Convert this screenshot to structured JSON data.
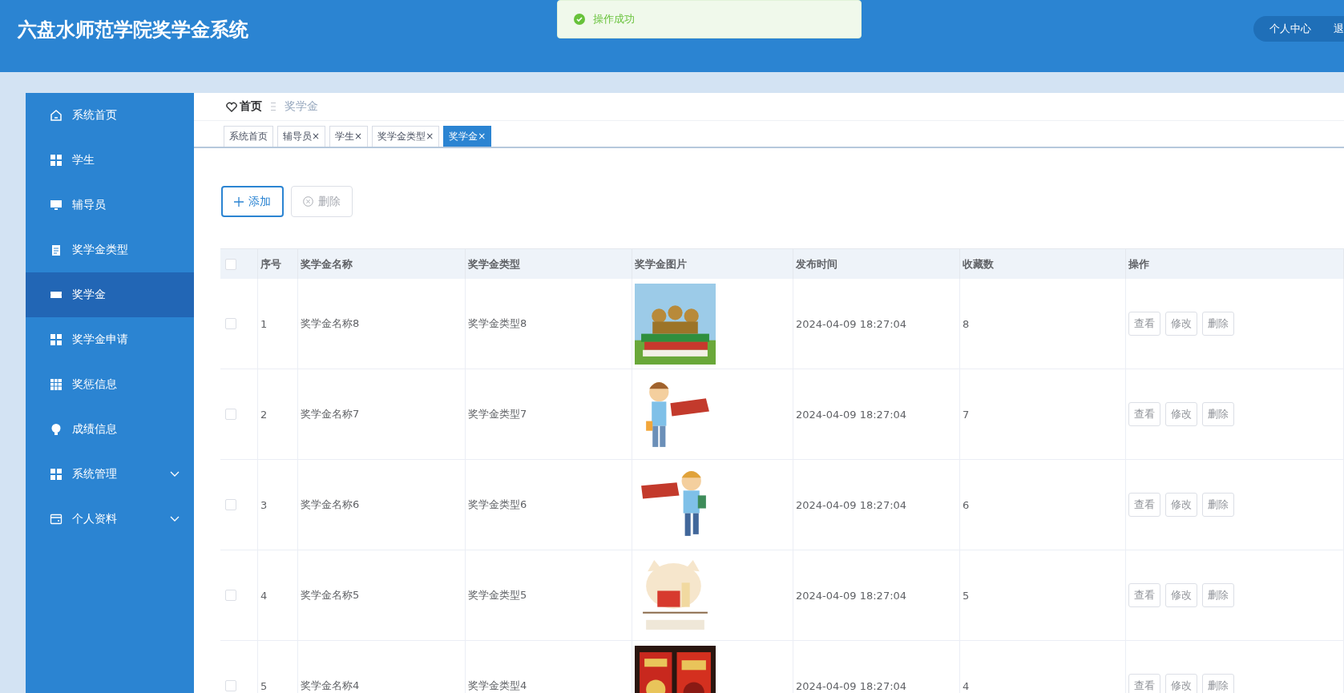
{
  "header": {
    "title": "六盘水师范学院奖学金系统",
    "links": [
      "个人中心",
      "退"
    ]
  },
  "toast": {
    "message": "操作成功"
  },
  "sidebar": {
    "items": [
      {
        "label": "系统首页",
        "kind": "home",
        "selected": false,
        "expandable": false
      },
      {
        "label": "学生",
        "kind": "grid",
        "selected": false,
        "expandable": false
      },
      {
        "label": "辅导员",
        "kind": "monitor",
        "selected": false,
        "expandable": false
      },
      {
        "label": "奖学金类型",
        "kind": "clipboard",
        "selected": false,
        "expandable": false
      },
      {
        "label": "奖学金",
        "kind": "ticket",
        "selected": true,
        "expandable": false
      },
      {
        "label": "奖学金申请",
        "kind": "grid",
        "selected": false,
        "expandable": false
      },
      {
        "label": "奖惩信息",
        "kind": "table",
        "selected": false,
        "expandable": false
      },
      {
        "label": "成绩信息",
        "kind": "bulb",
        "selected": false,
        "expandable": false
      },
      {
        "label": "系统管理",
        "kind": "grid",
        "selected": false,
        "expandable": true
      },
      {
        "label": "个人资料",
        "kind": "wallet",
        "selected": false,
        "expandable": true
      }
    ]
  },
  "breadcrumb": {
    "home": "首页",
    "current": "奖学金"
  },
  "tabs": [
    {
      "label": "系统首页",
      "selected": false
    },
    {
      "label": "辅导员",
      "close": "×",
      "selected": false
    },
    {
      "label": "学生",
      "close": "×",
      "selected": false
    },
    {
      "label": "奖学金类型",
      "close": "×",
      "selected": false
    },
    {
      "label": "奖学金",
      "close": "×",
      "selected": true
    }
  ],
  "toolbar": [
    {
      "label": "添加",
      "kind": "add",
      "disabled": false,
      "focused": true
    },
    {
      "label": "删除",
      "kind": "delete",
      "disabled": true,
      "focused": false
    }
  ],
  "table": {
    "all_checked": false,
    "columns": [
      "序号",
      "奖学金名称",
      "奖学金类型",
      "奖学金图片",
      "发布时间",
      "收藏数",
      "操作"
    ],
    "rows": [
      {
        "checked": false,
        "index": "1",
        "name": "奖学金名称8",
        "type": "奖学金类型8",
        "time": "2024-04-09 18:27:04",
        "favorites": "8",
        "actions": [
          "查看",
          "修改",
          "删除"
        ]
      },
      {
        "checked": false,
        "index": "2",
        "name": "奖学金名称7",
        "type": "奖学金类型7",
        "time": "2024-04-09 18:27:04",
        "favorites": "7",
        "actions": [
          "查看",
          "修改",
          "删除"
        ]
      },
      {
        "checked": false,
        "index": "3",
        "name": "奖学金名称6",
        "type": "奖学金类型6",
        "time": "2024-04-09 18:27:04",
        "favorites": "6",
        "actions": [
          "查看",
          "修改",
          "删除"
        ]
      },
      {
        "checked": false,
        "index": "4",
        "name": "奖学金名称5",
        "type": "奖学金类型5",
        "time": "2024-04-09 18:27:04",
        "favorites": "5",
        "actions": [
          "查看",
          "修改",
          "删除"
        ]
      },
      {
        "checked": false,
        "index": "5",
        "name": "奖学金名称4",
        "type": "奖学金类型4",
        "time": "2024-04-09 18:27:04",
        "favorites": "4",
        "actions": [
          "查看",
          "修改",
          "删除"
        ]
      }
    ]
  }
}
